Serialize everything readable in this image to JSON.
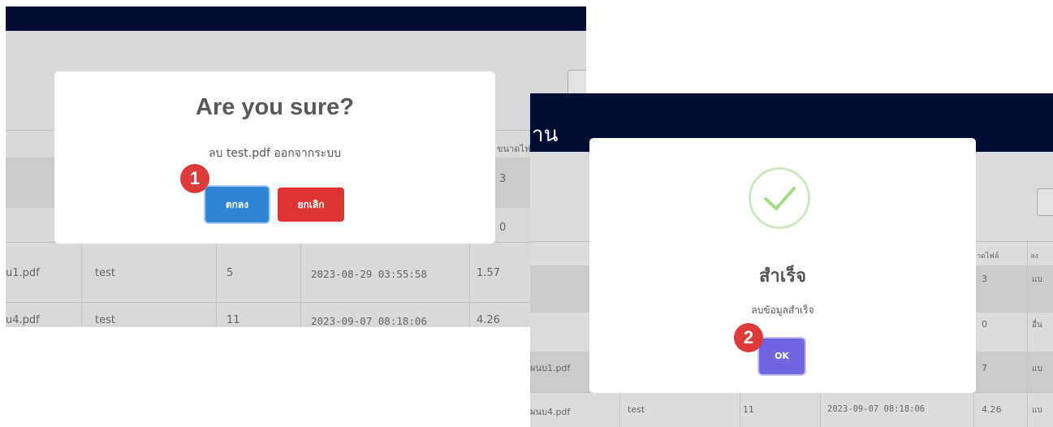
{
  "panel1": {
    "modal": {
      "title": "Are you sure?",
      "message": "ลบ test.pdf ออกจากระบบ",
      "confirm_label": "ตกลง",
      "cancel_label": "ยกเลิก"
    },
    "badge": "1",
    "header_fragment": "ขนาดไฟล์",
    "side_values": [
      "3",
      "0"
    ],
    "rows": [
      {
        "file": "u1.pdf",
        "user": "test",
        "pages": "5",
        "date": "2023-08-29 03:55:58",
        "size": "1.57"
      },
      {
        "file": "u4.pdf",
        "user": "test",
        "pages": "11",
        "date": "2023-09-07 08:18:06",
        "size": "4.26"
      }
    ]
  },
  "panel2": {
    "nav_fragment": "าน",
    "modal": {
      "title": "สำเร็จ",
      "message": "ลบข้อมูลสำเร็จ",
      "ok_label": "OK"
    },
    "badge": "2",
    "header_fragment": "าดไฟล์",
    "header_fragment2": "ลง",
    "right_values": [
      "3",
      "0",
      "7"
    ],
    "far_right": [
      "แบ",
      "อื่น",
      "แบ",
      "แบ"
    ],
    "rows": [
      {
        "file": "ผนบ1.pdf"
      },
      {
        "file": "ผนบ4.pdf",
        "user": "test",
        "pages": "11",
        "date": "2023-09-07 08:18:06",
        "size": "4.26",
        "extra": "แบ"
      }
    ]
  },
  "colors": {
    "navbar": "#020d36",
    "confirm": "#3085d6",
    "cancel": "#dd3333",
    "ok": "#7066e0",
    "badge": "#dd3a3a",
    "success": "#a5dc86"
  }
}
